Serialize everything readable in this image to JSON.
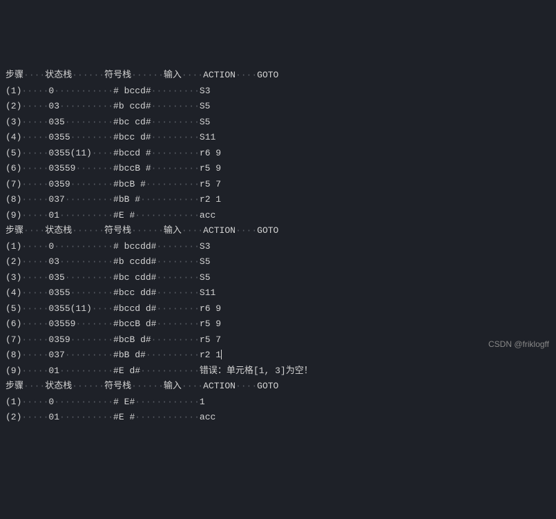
{
  "header": {
    "step": "步骤",
    "state_stack": "状态栈",
    "symbol_stack": "符号栈",
    "input": "输入",
    "action": "ACTION",
    "goto": "GOTO"
  },
  "dots_seq": "······",
  "table1": [
    {
      "step": "(1)",
      "state": "0",
      "sym": "# bccd#",
      "inp": "S3",
      "act": "",
      "gt": ""
    },
    {
      "step": "(2)",
      "state": "03",
      "sym": "#b ccd#",
      "inp": "S5",
      "act": "",
      "gt": ""
    },
    {
      "step": "(3)",
      "state": "035",
      "sym": "#bc cd#",
      "inp": "S5",
      "act": "",
      "gt": ""
    },
    {
      "step": "(4)",
      "state": "0355",
      "sym": "#bcc d#",
      "inp": "S11",
      "act": "",
      "gt": ""
    },
    {
      "step": "(5)",
      "state": "0355(11)",
      "sym": "#bccd #",
      "inp": "r6 9",
      "act": "",
      "gt": ""
    },
    {
      "step": "(6)",
      "state": "03559",
      "sym": "#bccB #",
      "inp": "r5 9",
      "act": "",
      "gt": ""
    },
    {
      "step": "(7)",
      "state": "0359",
      "sym": "#bcB #",
      "inp": "r5 7",
      "act": "",
      "gt": ""
    },
    {
      "step": "(8)",
      "state": "037",
      "sym": "#bB #",
      "inp": "r2 1",
      "act": "",
      "gt": ""
    },
    {
      "step": "(9)",
      "state": "01",
      "sym": "#E #",
      "inp": "acc",
      "act": "",
      "gt": ""
    }
  ],
  "table2": [
    {
      "step": "(1)",
      "state": "0",
      "sym": "# bccdd#",
      "inp": "S3",
      "act": "",
      "gt": ""
    },
    {
      "step": "(2)",
      "state": "03",
      "sym": "#b ccdd#",
      "inp": "S5",
      "act": "",
      "gt": ""
    },
    {
      "step": "(3)",
      "state": "035",
      "sym": "#bc cdd#",
      "inp": "S5",
      "act": "",
      "gt": ""
    },
    {
      "step": "(4)",
      "state": "0355",
      "sym": "#bcc dd#",
      "inp": "S11",
      "act": "",
      "gt": ""
    },
    {
      "step": "(5)",
      "state": "0355(11)",
      "sym": "#bccd d#",
      "inp": "r6 9",
      "act": "",
      "gt": ""
    },
    {
      "step": "(6)",
      "state": "03559",
      "sym": "#bccB d#",
      "inp": "r5 9",
      "act": "",
      "gt": ""
    },
    {
      "step": "(7)",
      "state": "0359",
      "sym": "#bcB d#",
      "inp": "r5 7",
      "act": "",
      "gt": ""
    },
    {
      "step": "(8)",
      "state": "037",
      "sym": "#bB d#",
      "inp": "r2 1",
      "act": "",
      "gt": "",
      "cursor": true
    },
    {
      "step": "(9)",
      "state": "01",
      "sym": "#E d#",
      "inp": "错误：单元格[1, 3]为空！",
      "act": "",
      "gt": ""
    }
  ],
  "table3": [
    {
      "step": "(1)",
      "state": "0",
      "sym": "# E#",
      "inp": "1",
      "act": "",
      "gt": ""
    },
    {
      "step": "(2)",
      "state": "01",
      "sym": "#E #",
      "inp": "acc",
      "act": "",
      "gt": ""
    }
  ],
  "watermark": "CSDN @friklogff"
}
